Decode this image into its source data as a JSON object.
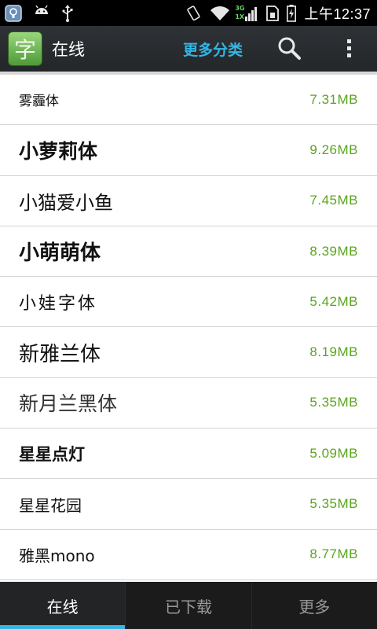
{
  "status_bar": {
    "time": "上午12:37",
    "network_badge_top": "3G",
    "network_badge_bottom": "1X",
    "icons": [
      "notification-icon",
      "android-icon",
      "usb-icon",
      "rotate-icon",
      "wifi-icon",
      "signal-icon",
      "sim-icon",
      "battery-icon"
    ]
  },
  "action_bar": {
    "app_icon_glyph": "字",
    "title": "在线",
    "more_categories": "更多分类",
    "icons": [
      "search-icon",
      "overflow-menu-icon"
    ]
  },
  "fonts": [
    {
      "name": "雾霾体",
      "size": "7.31MB"
    },
    {
      "name": "小萝莉体",
      "size": "9.26MB"
    },
    {
      "name": "小猫爱小鱼",
      "size": "7.45MB"
    },
    {
      "name": "小萌萌体",
      "size": "8.39MB"
    },
    {
      "name": "小娃字体",
      "size": "5.42MB"
    },
    {
      "name": "新雅兰体",
      "size": "8.19MB"
    },
    {
      "name": "新月兰黑体",
      "size": "5.35MB"
    },
    {
      "name": "星星点灯",
      "size": "5.09MB"
    },
    {
      "name": "星星花园",
      "size": "5.35MB"
    },
    {
      "name": "雅黑mono",
      "size": "8.77MB"
    }
  ],
  "tabs": [
    {
      "label": "在线",
      "active": true
    },
    {
      "label": "已下载",
      "active": false
    },
    {
      "label": "更多",
      "active": false
    }
  ],
  "colors": {
    "accent": "#33b5e5",
    "size_text": "#5aa51c",
    "action_bar": "#2b2f33",
    "tab_bar": "#1b1b1b"
  }
}
